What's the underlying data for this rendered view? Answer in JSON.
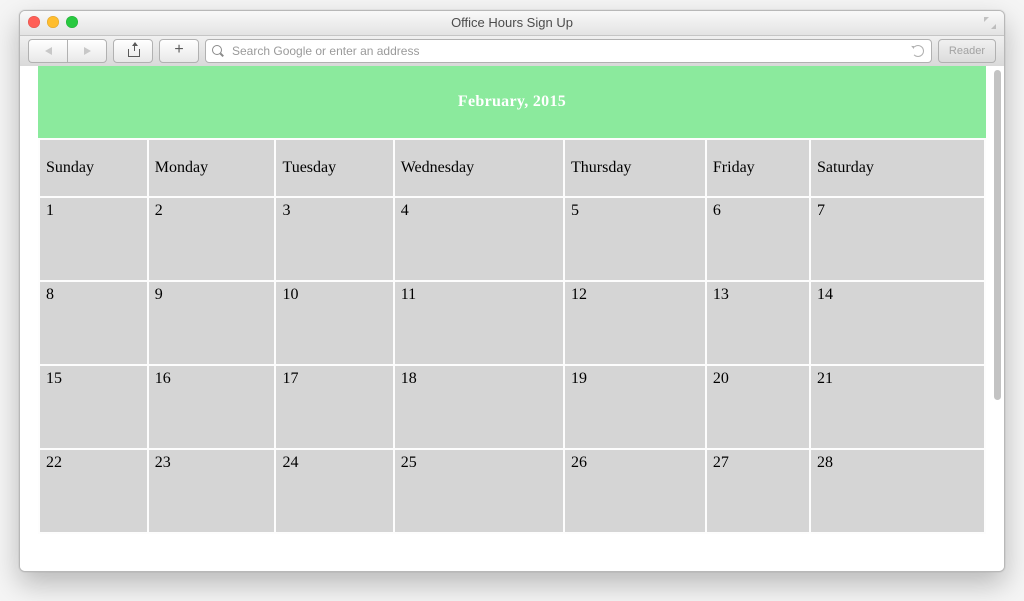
{
  "window": {
    "title": "Office Hours Sign Up"
  },
  "toolbar": {
    "reader_label": "Reader",
    "address_placeholder": "Search Google or enter an address"
  },
  "calendar": {
    "title": "February, 2015",
    "day_names": [
      "Sunday",
      "Monday",
      "Tuesday",
      "Wednesday",
      "Thursday",
      "Friday",
      "Saturday"
    ],
    "weeks": [
      [
        "1",
        "2",
        "3",
        "4",
        "5",
        "6",
        "7"
      ],
      [
        "8",
        "9",
        "10",
        "11",
        "12",
        "13",
        "14"
      ],
      [
        "15",
        "16",
        "17",
        "18",
        "19",
        "20",
        "21"
      ],
      [
        "22",
        "23",
        "24",
        "25",
        "26",
        "27",
        "28"
      ]
    ]
  },
  "colors": {
    "title_bg": "#8bea9d",
    "cell_bg": "#d5d5d5"
  }
}
